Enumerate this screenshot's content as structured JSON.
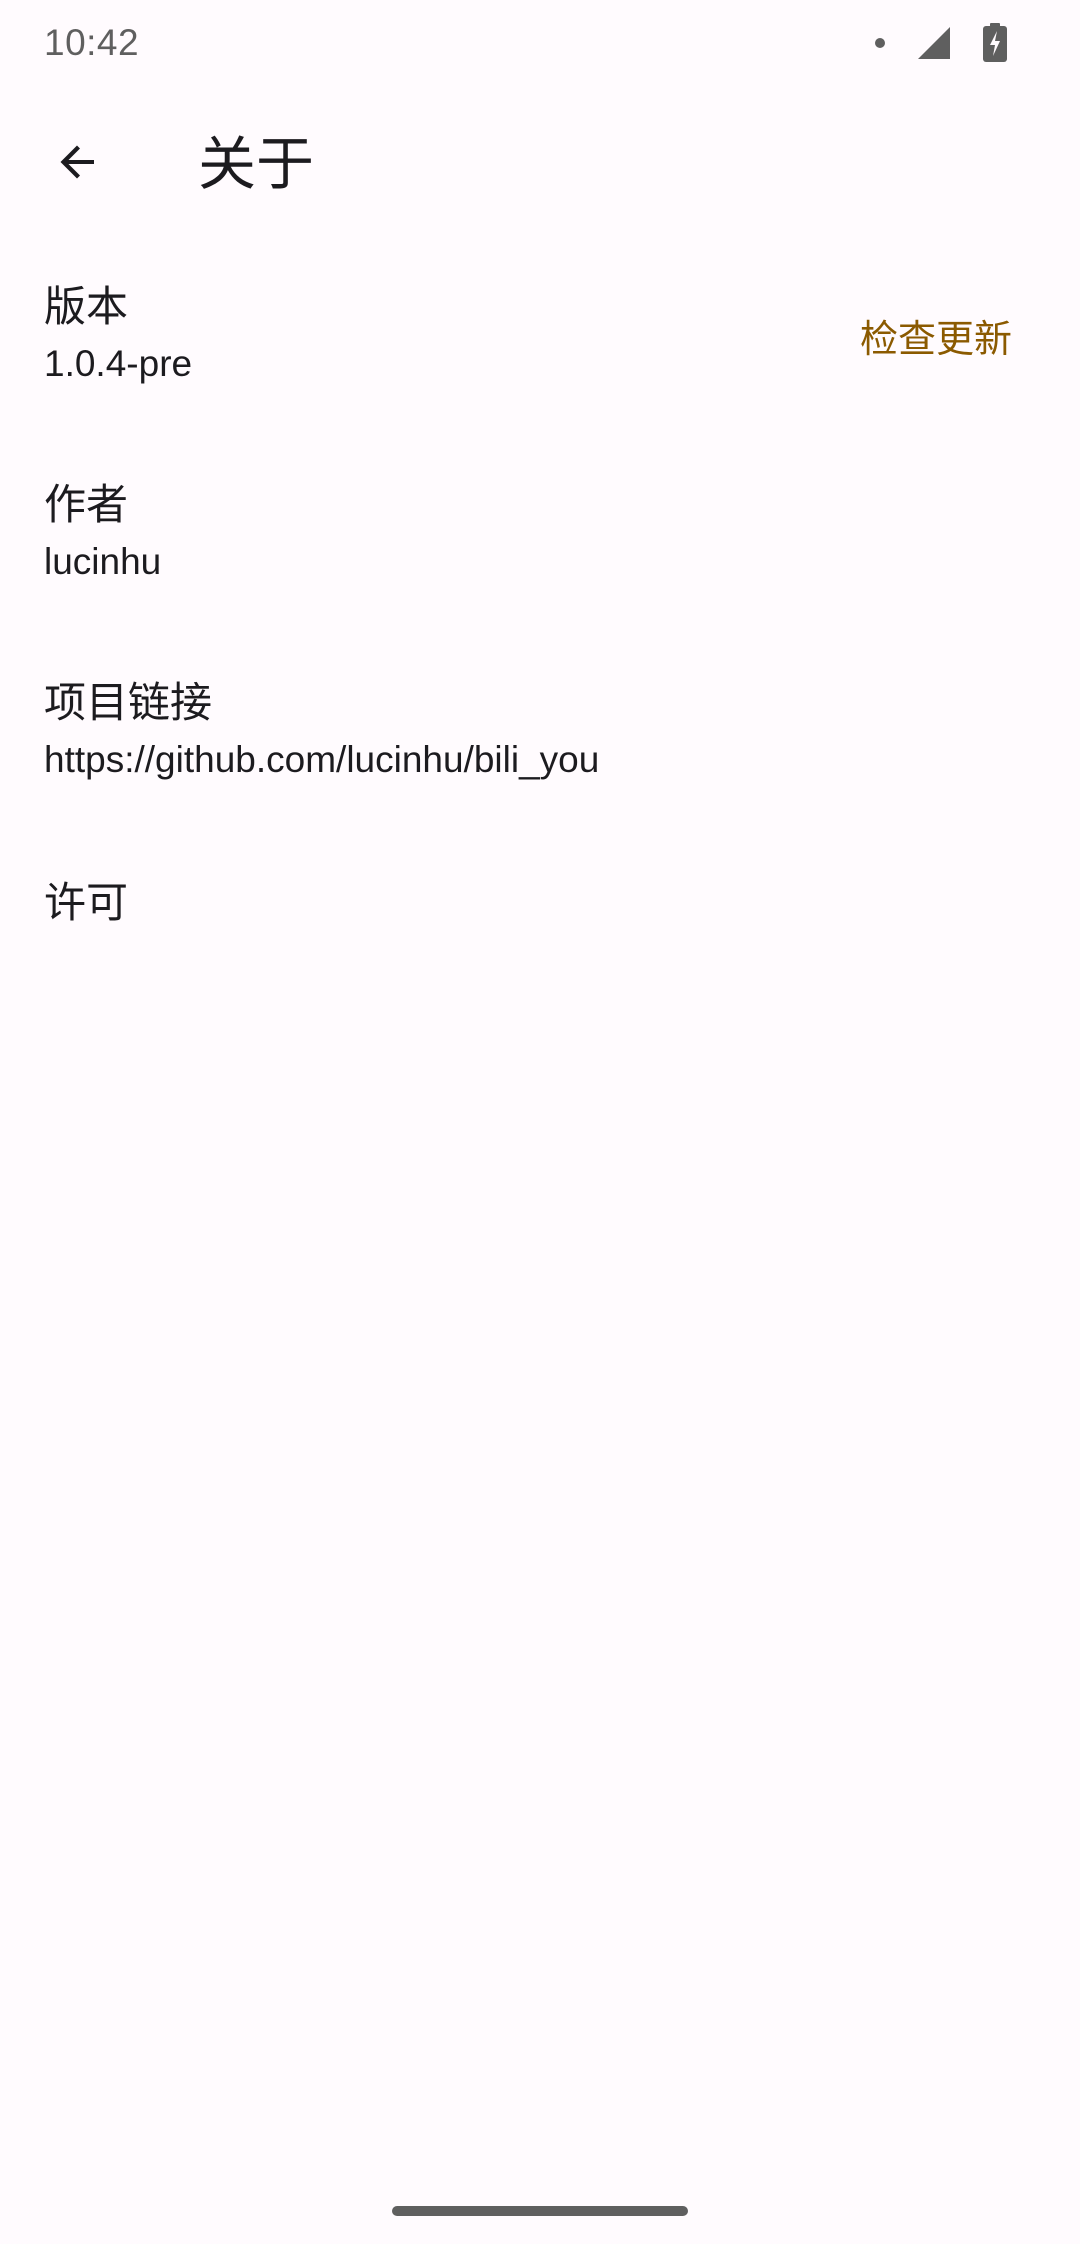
{
  "status_bar": {
    "time": "10:42"
  },
  "app_bar": {
    "title": "关于",
    "back_icon": "arrow-back-icon"
  },
  "items": [
    {
      "title": "版本",
      "subtitle": "1.0.4-pre",
      "action_label": "检查更新"
    },
    {
      "title": "作者",
      "subtitle": "lucinhu"
    },
    {
      "title": "项目链接",
      "subtitle": "https://github.com/lucinhu/bili_you"
    },
    {
      "title": "许可"
    }
  ],
  "colors": {
    "background": "#fffbfe",
    "accent": "#8b5a00",
    "text": "#1c1b1f"
  }
}
